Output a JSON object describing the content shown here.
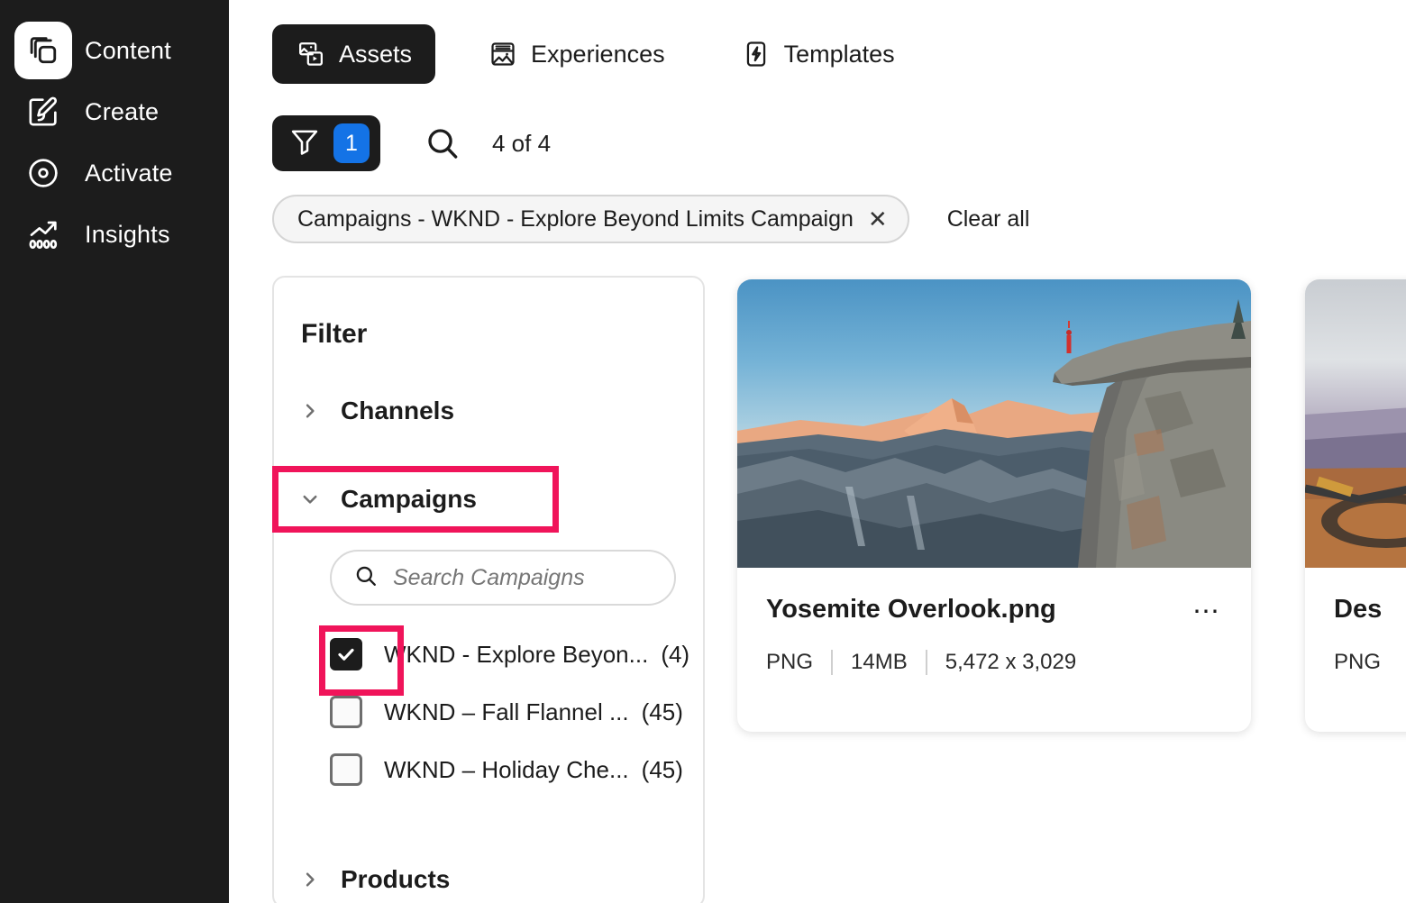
{
  "sidebar": {
    "items": [
      {
        "label": "Content",
        "icon": "layers-icon",
        "active": true
      },
      {
        "label": "Create",
        "icon": "edit-brush-icon",
        "active": false
      },
      {
        "label": "Activate",
        "icon": "target-icon",
        "active": false
      },
      {
        "label": "Insights",
        "icon": "chart-icon",
        "active": false
      }
    ]
  },
  "tabs": [
    {
      "label": "Assets",
      "icon": "assets-icon",
      "active": true
    },
    {
      "label": "Experiences",
      "icon": "experiences-icon",
      "active": false
    },
    {
      "label": "Templates",
      "icon": "templates-icon",
      "active": false
    }
  ],
  "toolbar": {
    "filter_icon": "funnel-icon",
    "filter_count": "1",
    "search_icon": "search-icon",
    "result_count": "4 of 4"
  },
  "chips": {
    "items": [
      {
        "label": "Campaigns - WKND - Explore Beyond Limits Campaign",
        "remove_icon": "close-icon"
      }
    ],
    "clear_all": "Clear all"
  },
  "filter_panel": {
    "title": "Filter",
    "facets": [
      {
        "label": "Channels",
        "expanded": false,
        "chevron": "chevron-right-icon",
        "highlighted": false
      },
      {
        "label": "Campaigns",
        "expanded": true,
        "chevron": "chevron-down-icon",
        "highlighted": true
      },
      {
        "label": "Products",
        "expanded": false,
        "chevron": "chevron-right-icon",
        "highlighted": false
      }
    ],
    "campaign_search": {
      "placeholder": "Search Campaigns",
      "value": "",
      "icon": "search-icon"
    },
    "campaign_options": [
      {
        "label": "WKND - Explore Beyon...",
        "count": "(4)",
        "checked": true,
        "highlighted": true
      },
      {
        "label": "WKND – Fall Flannel ...",
        "count": "(45)",
        "checked": false,
        "highlighted": false
      },
      {
        "label": "WKND – Holiday Che...",
        "count": "(45)",
        "checked": false,
        "highlighted": false
      }
    ]
  },
  "assets": [
    {
      "title": "Yosemite Overlook.png",
      "format": "PNG",
      "size": "14MB",
      "dimensions": "5,472 x 3,029",
      "more_icon": "more-options-icon",
      "thumb": "yosemite-overlook-photo"
    },
    {
      "title": "Des",
      "format": "PNG",
      "size": "",
      "dimensions": "",
      "more_icon": "more-options-icon",
      "thumb": "desert-bike-photo"
    }
  ],
  "colors": {
    "sidebar_bg": "#1c1c1c",
    "accent_blue": "#1473e6",
    "highlight_pink": "#f0145a",
    "text_primary": "#1c1c1c"
  }
}
